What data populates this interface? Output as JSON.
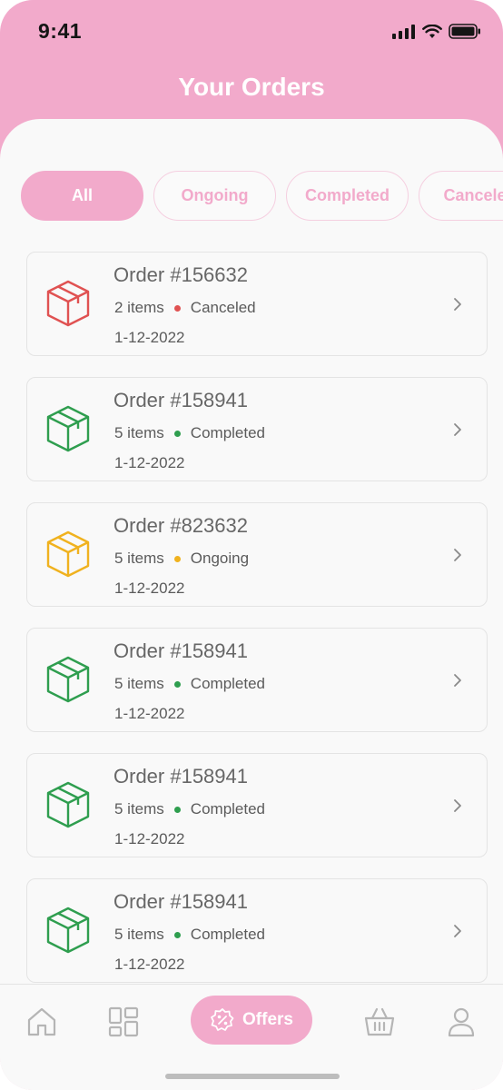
{
  "status_bar": {
    "time": "9:41"
  },
  "header": {
    "title": "Your Orders"
  },
  "tabs": [
    {
      "label": "All",
      "active": true
    },
    {
      "label": "Ongoing",
      "active": false
    },
    {
      "label": "Completed",
      "active": false
    },
    {
      "label": "Canceled",
      "active": false
    }
  ],
  "orders": [
    {
      "title": "Order #156632",
      "items": "2 items",
      "status": "Canceled",
      "date": "1-12-2022",
      "color": "#e05252"
    },
    {
      "title": "Order #158941",
      "items": "5 items",
      "status": "Completed",
      "date": "1-12-2022",
      "color": "#2f9e4f"
    },
    {
      "title": "Order #823632",
      "items": "5 items",
      "status": "Ongoing",
      "date": "1-12-2022",
      "color": "#f0b21f"
    },
    {
      "title": "Order #158941",
      "items": "5 items",
      "status": "Completed",
      "date": "1-12-2022",
      "color": "#2f9e4f"
    },
    {
      "title": "Order #158941",
      "items": "5 items",
      "status": "Completed",
      "date": "1-12-2022",
      "color": "#2f9e4f"
    },
    {
      "title": "Order #158941",
      "items": "5 items",
      "status": "Completed",
      "date": "1-12-2022",
      "color": "#2f9e4f"
    }
  ],
  "bottom_nav": {
    "offers_label": "Offers",
    "icons": [
      "home-icon",
      "dashboard-icon",
      "discount-icon",
      "basket-icon",
      "profile-icon"
    ]
  },
  "colors": {
    "brand": "#f2aacb",
    "canceled": "#e05252",
    "completed": "#2f9e4f",
    "ongoing": "#f0b21f"
  }
}
